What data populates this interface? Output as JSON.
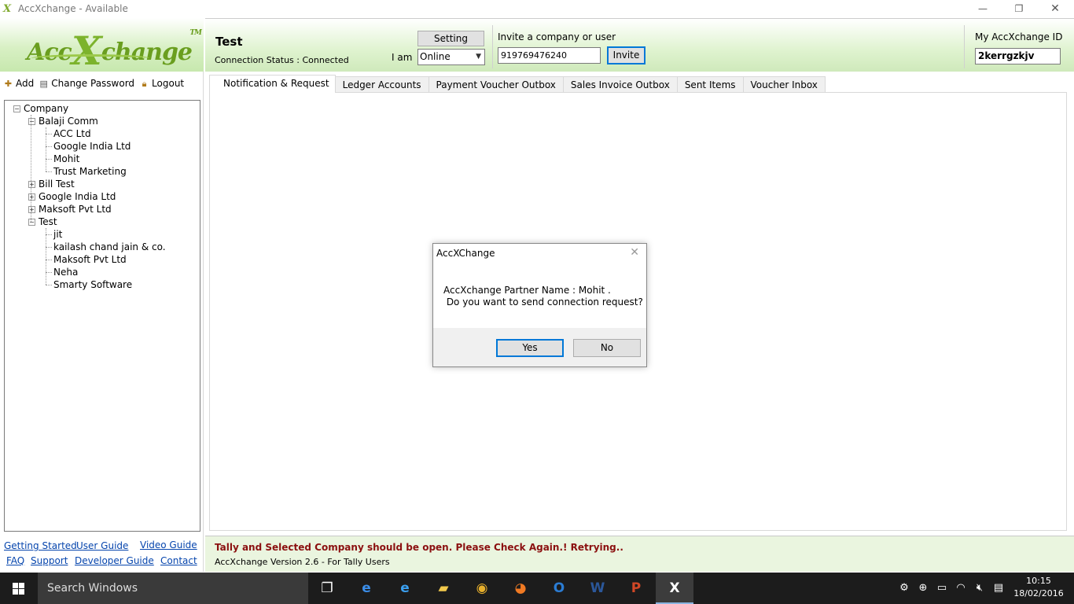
{
  "window": {
    "title": "AccXchange - Available",
    "controls": {
      "minimize": "—",
      "maximize": "❐",
      "close": "✕"
    }
  },
  "logo": {
    "pre": "Acc",
    "x": "X",
    "post": "change",
    "tm": "TM"
  },
  "toolbar": {
    "add": "Add",
    "change_password": "Change Password",
    "logout": "Logout"
  },
  "tree": {
    "root": "Company",
    "groups": [
      {
        "label": "Balaji Comm",
        "expanded": true,
        "children": [
          "ACC Ltd",
          "Google India Ltd",
          "Mohit",
          "Trust Marketing"
        ]
      },
      {
        "label": "Bill Test",
        "expanded": false,
        "children": []
      },
      {
        "label": "Google India Ltd",
        "expanded": false,
        "children": []
      },
      {
        "label": "Maksoft Pvt Ltd",
        "expanded": false,
        "children": []
      },
      {
        "label": "Test",
        "expanded": true,
        "children": [
          "jit",
          "kailash chand jain & co.",
          "Maksoft Pvt Ltd",
          "Neha",
          "Smarty Software"
        ]
      }
    ]
  },
  "links": {
    "getting_started": "Getting Started",
    "user_guide": "User Guide",
    "video_guide": "Video Guide",
    "faq": "FAQ",
    "support": "Support",
    "developer_guide": "Developer Guide",
    "contact": "Contact"
  },
  "header": {
    "company": "Test",
    "connection_status": "Connection Status : Connected",
    "setting_label": "Setting",
    "iam_label": "I am",
    "iam_value": "Online",
    "invite_label": "Invite a company or user",
    "invite_value": "919769476240",
    "invite_button": "Invite",
    "myid_label": "My AccXchange ID",
    "myid_value": "2kerrgzkjv"
  },
  "tabs": [
    "Notification & Request",
    "Ledger Accounts",
    "Payment Voucher Outbox",
    "Sales Invoice Outbox",
    "Sent Items",
    "Voucher Inbox"
  ],
  "status": {
    "warning": "Tally and Selected Company should be open. Please Check Again.! Retrying..",
    "version": "AccXchange Version 2.6 - For Tally Users"
  },
  "dialog": {
    "title": "AccXChange",
    "close": "✕",
    "line1": "AccXchange Partner Name : Mohit .",
    "line2": " Do you want to send connection request?",
    "yes": "Yes",
    "no": "No"
  },
  "taskbar": {
    "search_placeholder": "Search Windows",
    "apps": [
      {
        "name": "task-view",
        "glyph": "❐",
        "color": "#ffffff"
      },
      {
        "name": "edge",
        "glyph": "e",
        "color": "#3b8eea"
      },
      {
        "name": "internet-explorer",
        "glyph": "e",
        "color": "#3ba0f0"
      },
      {
        "name": "file-explorer",
        "glyph": "▰",
        "color": "#f2c94c"
      },
      {
        "name": "chrome",
        "glyph": "◉",
        "color": "#e8b02c"
      },
      {
        "name": "firefox",
        "glyph": "◕",
        "color": "#f07a23"
      },
      {
        "name": "outlook",
        "glyph": "O",
        "color": "#2b7cd3"
      },
      {
        "name": "word",
        "glyph": "W",
        "color": "#2b579a"
      },
      {
        "name": "powerpoint",
        "glyph": "P",
        "color": "#d24726"
      },
      {
        "name": "accxchange",
        "glyph": "X",
        "color": "#ffffff"
      }
    ],
    "time": "10:15",
    "date": "18/02/2016"
  },
  "colors": {
    "accent_green": "#7cb32c",
    "warning_red": "#8b1010",
    "link_blue": "#0645ad",
    "focus_blue": "#0078d7"
  }
}
